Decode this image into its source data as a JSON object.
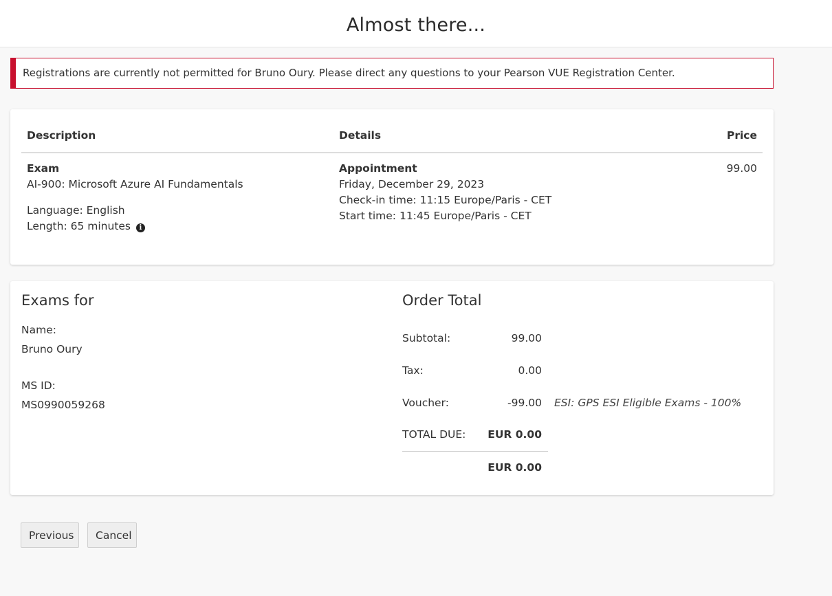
{
  "header": {
    "title": "Almost there..."
  },
  "alert": {
    "message": "Registrations are currently not permitted for Bruno Oury. Please direct any questions to your Pearson VUE Registration Center."
  },
  "cart": {
    "columns": {
      "description": "Description",
      "details": "Details",
      "price": "Price"
    },
    "item": {
      "type": "Exam",
      "name": "AI-900: Microsoft Azure AI Fundamentals",
      "language": "Language: English",
      "length": "Length: 65 minutes",
      "appointment_label": "Appointment",
      "date": "Friday, December 29, 2023",
      "checkin": "Check-in time: 11:15 Europe/Paris - CET",
      "start": "Start time: 11:45 Europe/Paris - CET",
      "price": "99.00"
    }
  },
  "candidate": {
    "title": "Exams for",
    "name_label": "Name:",
    "name_value": "Bruno Oury",
    "msid_label": "MS ID:",
    "msid_value": "MS0990059268"
  },
  "order": {
    "title": "Order Total",
    "subtotal_label": "Subtotal:",
    "subtotal_value": "99.00",
    "tax_label": "Tax:",
    "tax_value": "0.00",
    "voucher_label": "Voucher:",
    "voucher_value": "-99.00",
    "voucher_note": "ESI: GPS ESI Eligible Exams - 100%",
    "total_label": "TOTAL DUE:",
    "total_value": "EUR 0.00",
    "grand_total": "EUR 0.00"
  },
  "buttons": {
    "previous": "Previous",
    "cancel": "Cancel"
  },
  "colors": {
    "alert_red": "#c8102e",
    "background": "#f8f8f8",
    "card": "#ffffff"
  },
  "icons": {
    "info": "info-circle-icon"
  }
}
